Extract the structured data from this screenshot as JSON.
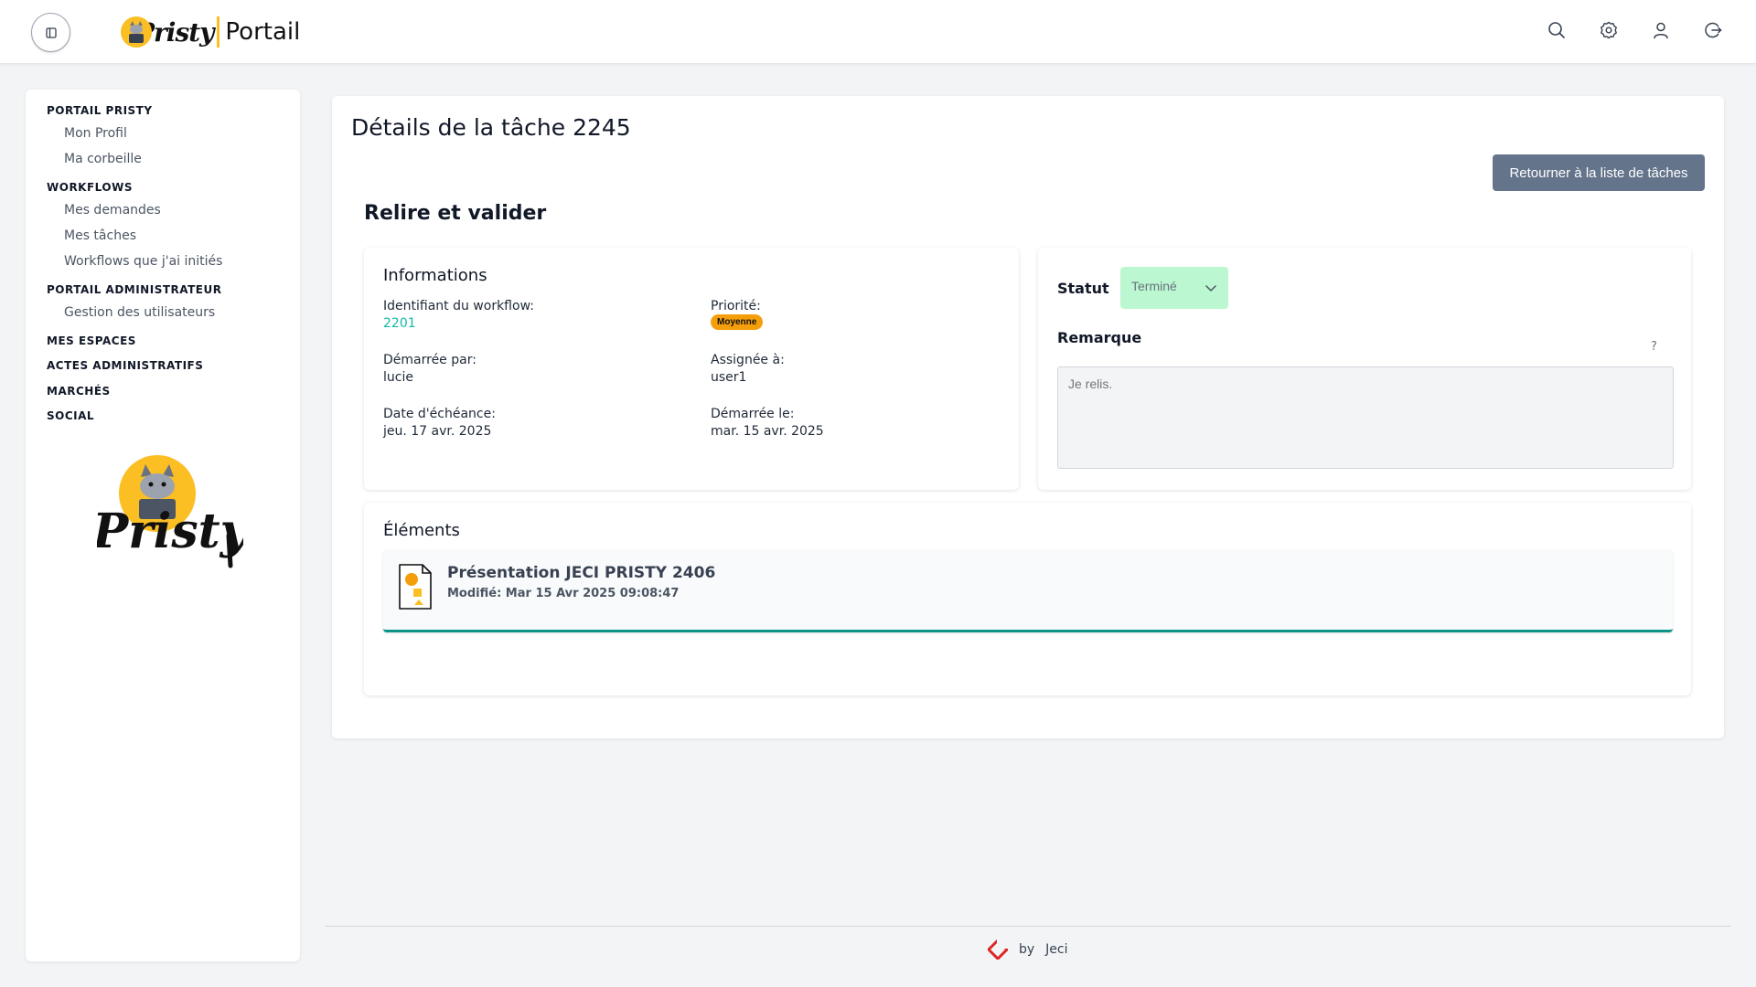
{
  "header": {
    "logo_script": "Pristy",
    "logo_portail": "Portail",
    "icons": [
      "search-icon",
      "gear-icon",
      "user-icon",
      "logout-icon"
    ]
  },
  "sidebar": {
    "sections": [
      {
        "label": "PORTAIL PRISTY",
        "items": [
          "Mon Profil",
          "Ma corbeille"
        ]
      },
      {
        "label": "WORKFLOWS",
        "items": [
          "Mes demandes",
          "Mes tâches",
          "Workflows que j'ai initiés"
        ]
      },
      {
        "label": "PORTAIL ADMINISTRATEUR",
        "items": [
          "Gestion des utilisateurs"
        ]
      },
      {
        "label": "MES ESPACES",
        "items": []
      },
      {
        "label": "ACTES ADMINISTRATIFS",
        "items": []
      },
      {
        "label": "MARCHÉS",
        "items": []
      },
      {
        "label": "SOCIAL",
        "items": []
      }
    ],
    "mascot_text": "Pristy"
  },
  "main": {
    "title": "Détails de la tâche 2245",
    "back_button": "Retourner à la liste de tâches",
    "task_name": "Relire et valider",
    "info": {
      "title": "Informations",
      "workflow_id_label": "Identifiant du workflow:",
      "workflow_id": "2201",
      "priority_label": "Priorité:",
      "priority": "Moyenne",
      "started_by_label": "Démarrée par:",
      "started_by": "lucie",
      "assigned_label": "Assignée à:",
      "assigned": "user1",
      "due_label": "Date d'échéance:",
      "due": "jeu. 17 avr. 2025",
      "started_on_label": "Démarrée le:",
      "started_on": "mar. 15 avr. 2025"
    },
    "status": {
      "label": "Statut",
      "value": "Terminé",
      "remark_label": "Remarque",
      "help": "?",
      "remark_value": "Je relis."
    },
    "elements": {
      "title": "Éléments",
      "items": [
        {
          "name": "Présentation JECI PRISTY 2406",
          "modified": "Modifié: Mar 15 Avr 2025 09:08:47"
        }
      ]
    }
  },
  "footer": {
    "by": "by",
    "brand": "Jeci"
  },
  "colors": {
    "accent_teal": "#14b8a6",
    "priority_orange": "#f59e0b",
    "status_green": "#bbf7d0",
    "button_slate": "#64748b",
    "brand_yellow": "#fbbf24"
  }
}
